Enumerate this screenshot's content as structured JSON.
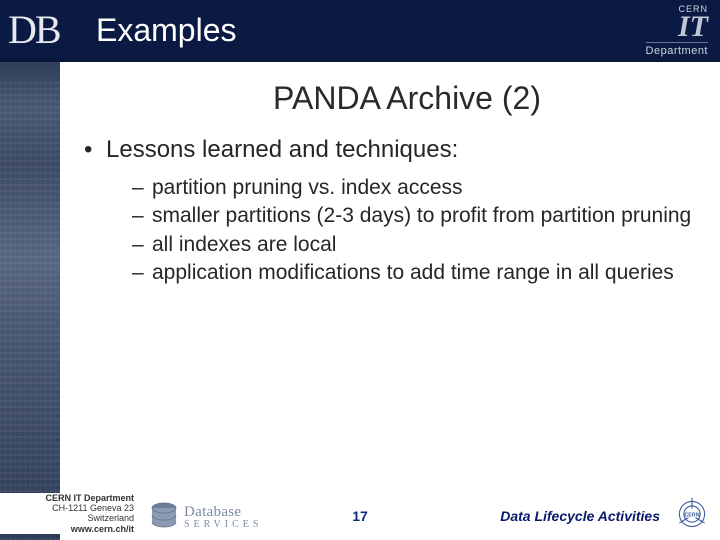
{
  "header": {
    "logo_text": "DB",
    "section_title": "Examples",
    "brand_top": "CERN",
    "brand_it": "IT",
    "brand_dept": "Department"
  },
  "content": {
    "title": "PANDA Archive (2)",
    "bullet1": "Lessons learned and techniques:",
    "sub1": "partition pruning vs. index access",
    "sub2": "smaller partitions (2-3 days) to profit from partition pruning",
    "sub3": "all indexes are local",
    "sub4": "application modifications to add time range in all queries"
  },
  "footer": {
    "addr1": "CERN IT Department",
    "addr2": "CH-1211 Geneva 23",
    "addr3": "Switzerland",
    "addr4": "www.cern.ch/it",
    "db_services_1": "Database",
    "db_services_2": "SERVICES",
    "page_number": "17",
    "right_text": "Data Lifecycle Activities"
  },
  "colors": {
    "header_bg": "#0a1a42",
    "accent": "#0a1a6a"
  }
}
